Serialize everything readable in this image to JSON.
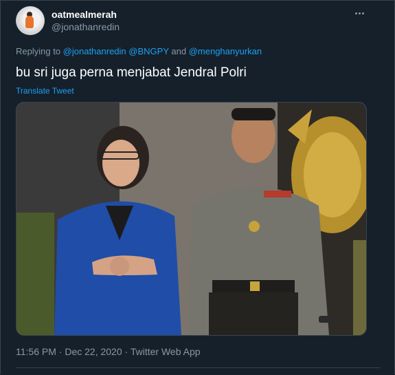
{
  "tweet": {
    "display_name": "oatmealmerah",
    "handle": "@jonathanredin",
    "replying_prefix": "Replying to",
    "replying_to": [
      "@jonathanredin",
      "@BNGPY"
    ],
    "replying_and": "and",
    "replying_last": "@menghanyurkan",
    "text": "bu sri juga perna menjabat Jendral Polri",
    "translate_label": "Translate Tweet",
    "time": "11:56 PM",
    "separator": "·",
    "date": "Dec 22, 2020",
    "source": "Twitter Web App"
  },
  "icons": {
    "more": "more-horizontal-icon"
  },
  "colors": {
    "background": "#15202b",
    "link": "#1da1f2",
    "muted": "#8899a6",
    "text": "#ffffff",
    "border": "#38444d"
  }
}
